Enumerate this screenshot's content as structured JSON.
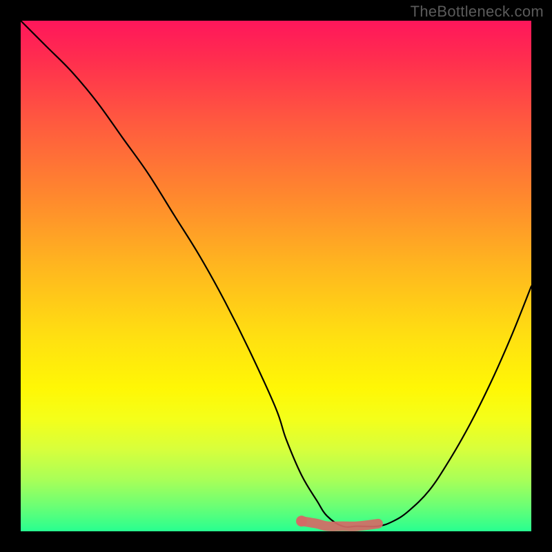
{
  "watermark": "TheBottleneck.com",
  "colors": {
    "background": "#000000",
    "curve": "#000000",
    "highlight": "#d46a66",
    "gradient_stops": [
      "#ff165b",
      "#ff2f4e",
      "#ff5a3f",
      "#ff8a2d",
      "#ffb61f",
      "#ffe011",
      "#fff705",
      "#f4ff1a",
      "#d7ff3c",
      "#a8ff58",
      "#6cff74",
      "#28ff90"
    ]
  },
  "chart_data": {
    "type": "line",
    "title": "",
    "xlabel": "",
    "ylabel": "",
    "xlim": [
      0,
      100
    ],
    "ylim": [
      0,
      100
    ],
    "grid": false,
    "series": [
      {
        "name": "bottleneck-curve",
        "x": [
          0,
          5,
          10,
          15,
          20,
          25,
          30,
          35,
          40,
          45,
          50,
          52,
          55,
          58,
          60,
          63,
          66,
          70,
          73,
          76,
          80,
          84,
          88,
          92,
          96,
          100
        ],
        "values": [
          100,
          95,
          90,
          84,
          77,
          70,
          62,
          54,
          45,
          35,
          24,
          18,
          11,
          6,
          3,
          1,
          1,
          1,
          2,
          4,
          8,
          14,
          21,
          29,
          38,
          48
        ]
      },
      {
        "name": "optimal-range-highlight",
        "x": [
          55,
          58,
          60,
          63,
          66,
          70
        ],
        "values": [
          2,
          1.5,
          1,
          1,
          1,
          1.5
        ]
      }
    ],
    "annotations": [
      {
        "text": "TheBottleneck.com",
        "position": "top-right"
      }
    ]
  }
}
